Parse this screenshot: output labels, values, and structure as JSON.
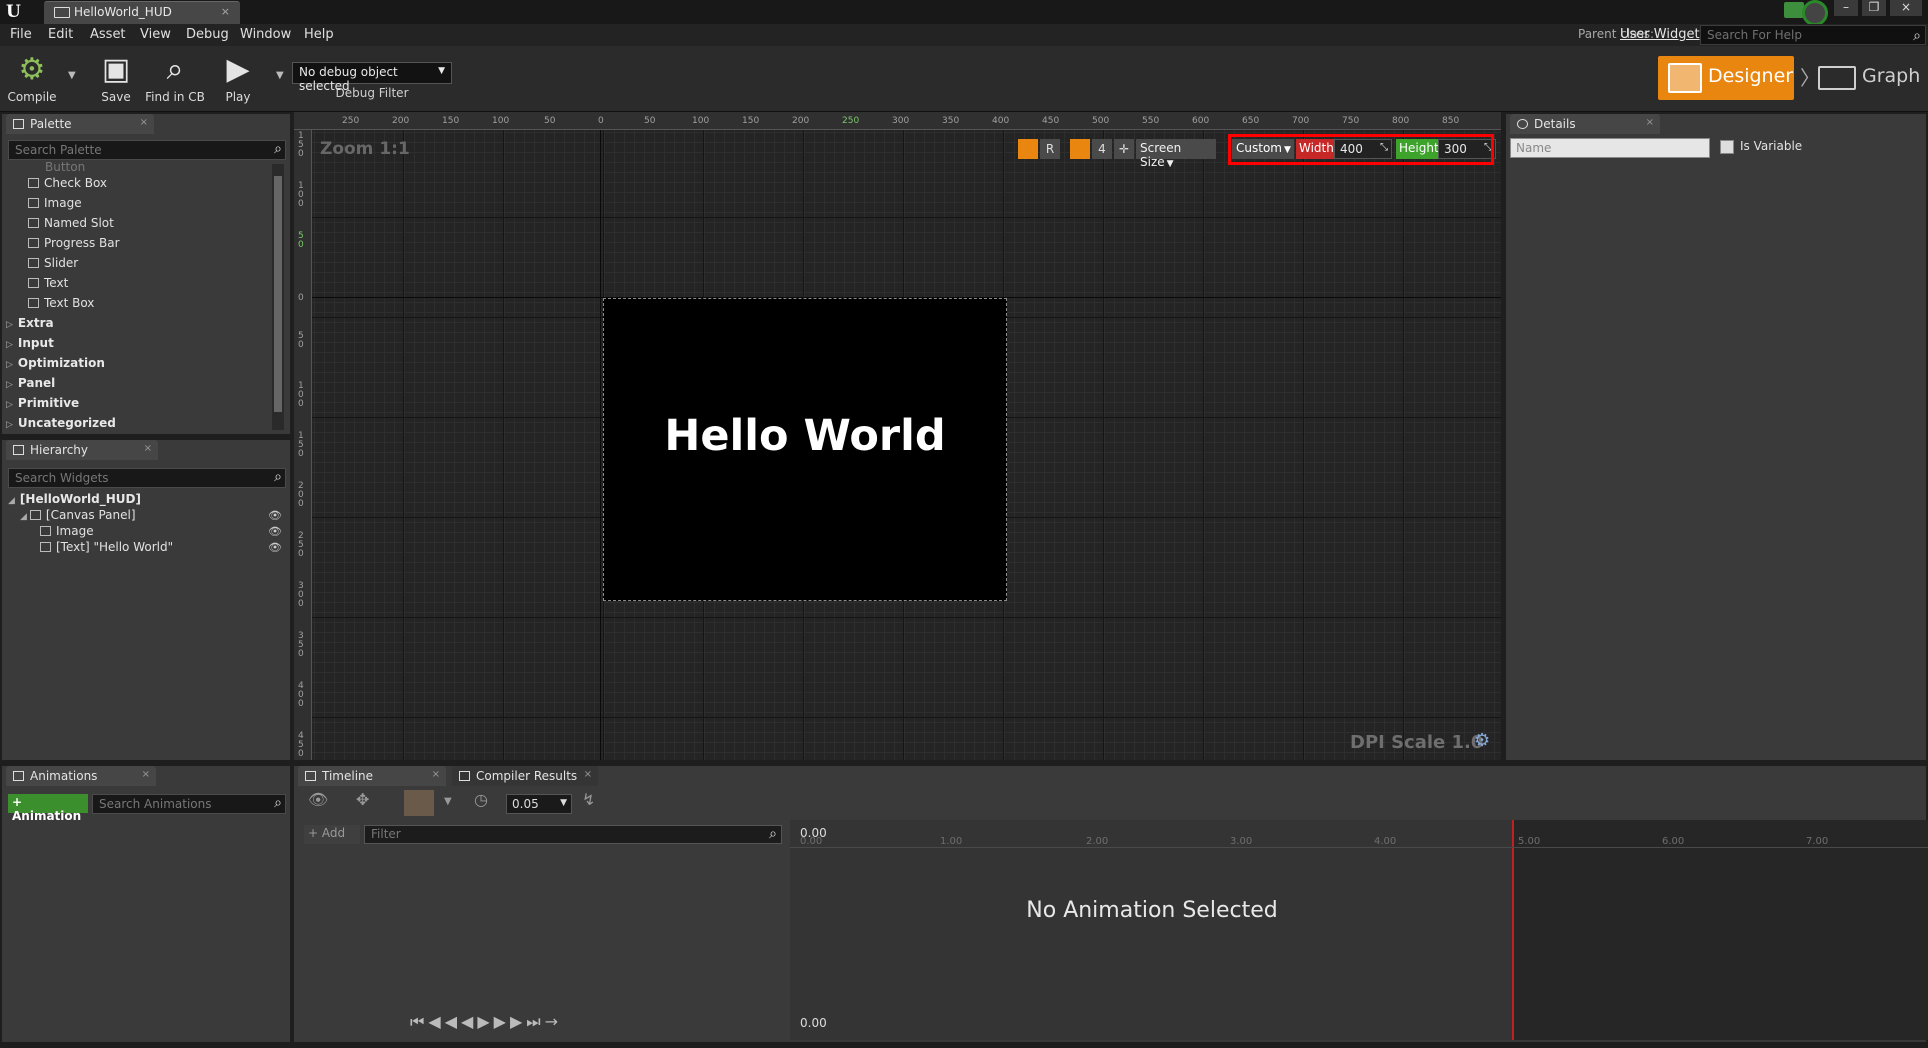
{
  "titlebar": {
    "doc_tab": "HelloWorld_HUD",
    "close": "×"
  },
  "window_controls": {
    "minimize": "–",
    "restore": "❐",
    "close": "×"
  },
  "menu": [
    "File",
    "Edit",
    "Asset",
    "View",
    "Debug",
    "Window",
    "Help"
  ],
  "parent_class": {
    "label": "Parent class:",
    "value": "User Widget"
  },
  "help_search": {
    "placeholder": "Search For Help"
  },
  "toolbar": {
    "compile": "Compile",
    "save": "Save",
    "find_in_cb": "Find in CB",
    "play": "Play",
    "debug_select": "No debug object selected",
    "debug_filter": "Debug Filter",
    "designer": "Designer",
    "graph": "Graph"
  },
  "palette": {
    "tab": "Palette",
    "search_placeholder": "Search Palette",
    "partial_item": "Button",
    "items": [
      "Check Box",
      "Image",
      "Named Slot",
      "Progress Bar",
      "Slider",
      "Text",
      "Text Box"
    ],
    "categories": [
      "Extra",
      "Input",
      "Optimization",
      "Panel",
      "Primitive",
      "Uncategorized"
    ]
  },
  "hierarchy": {
    "tab": "Hierarchy",
    "search_placeholder": "Search Widgets",
    "root": "[HelloWorld_HUD]",
    "canvas": "[Canvas Panel]",
    "image": "Image",
    "text": "[Text] \"Hello World\""
  },
  "viewport": {
    "zoom": "Zoom 1:1",
    "dpi": "DPI Scale 1.0",
    "ruler_top": [
      "250",
      "200",
      "150",
      "100",
      "50",
      "0",
      "50",
      "100",
      "150",
      "200",
      "250",
      "300",
      "350",
      "400",
      "450",
      "500",
      "550",
      "600",
      "650",
      "700",
      "750",
      "800",
      "850"
    ],
    "ruler_left": [
      "150",
      "100",
      "50",
      "0",
      "50",
      "100",
      "150",
      "200",
      "250",
      "300",
      "350",
      "400",
      "450"
    ],
    "canvas_text": "Hello World",
    "r_btn": "R",
    "grid_num": "4",
    "screen_size": "Screen Size",
    "custom": "Custom",
    "width_label": "Width",
    "width_value": "400",
    "height_label": "Height",
    "height_value": "300"
  },
  "details": {
    "tab": "Details",
    "name_placeholder": "Name",
    "is_variable": "Is Variable"
  },
  "animations": {
    "tab": "Animations",
    "add_btn": "+ Animation",
    "search_placeholder": "Search Animations"
  },
  "timeline": {
    "tab": "Timeline",
    "compiler_tab": "Compiler Results",
    "step_value": "0.05",
    "add_btn": "+ Add",
    "filter_placeholder": "Filter",
    "no_anim": "No Animation Selected",
    "time_start": "0.00",
    "ticks": [
      "0.00",
      "1.00",
      "2.00",
      "3.00",
      "4.00",
      "5.00",
      "6.00",
      "7.00"
    ]
  },
  "colors": {
    "accent": "#e8860f",
    "width": "#c62828",
    "height": "#3ea32a",
    "highlight": "#ff0000"
  }
}
